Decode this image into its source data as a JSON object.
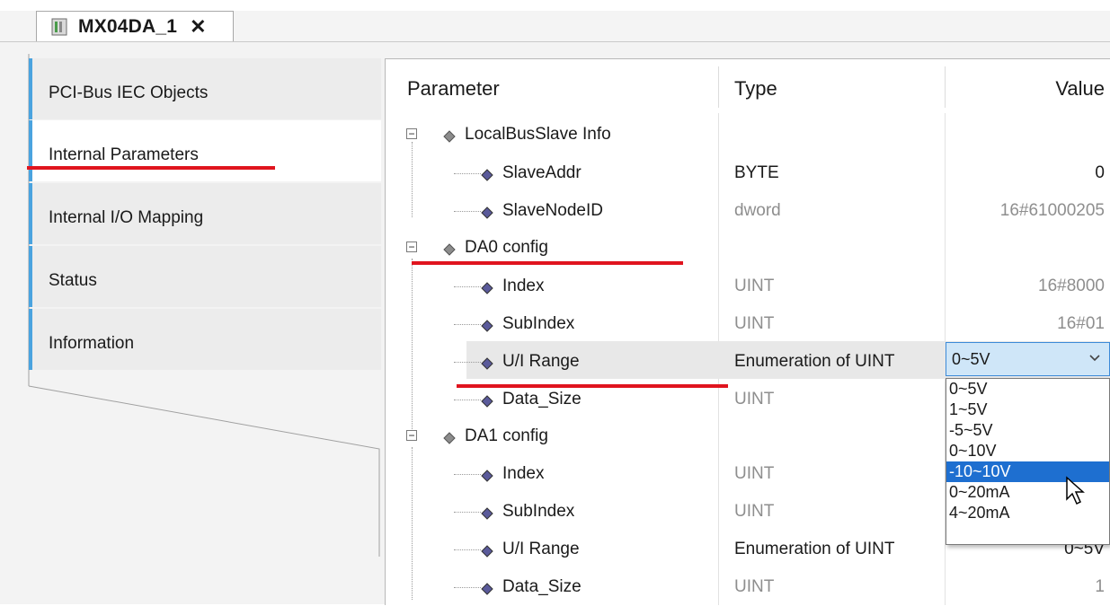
{
  "tab": {
    "title": "MX04DA_1",
    "close": "✕"
  },
  "sidebar": {
    "items": [
      {
        "label": "PCI-Bus IEC Objects"
      },
      {
        "label": "Internal Parameters"
      },
      {
        "label": "Internal I/O Mapping"
      },
      {
        "label": "Status"
      },
      {
        "label": "Information"
      }
    ]
  },
  "table": {
    "headers": {
      "parameter": "Parameter",
      "type": "Type",
      "value": "Value"
    },
    "rows": [
      {
        "label": "LocalBusSlave Info",
        "type": "",
        "value": ""
      },
      {
        "label": "SlaveAddr",
        "type": "BYTE",
        "value": "0"
      },
      {
        "label": "SlaveNodeID",
        "type": "dword",
        "value": "16#61000205"
      },
      {
        "label": "DA0 config",
        "type": "",
        "value": ""
      },
      {
        "label": "Index",
        "type": "UINT",
        "value": "16#8000"
      },
      {
        "label": "SubIndex",
        "type": "UINT",
        "value": "16#01"
      },
      {
        "label": "U/I Range",
        "type": "Enumeration of UINT",
        "value": "0~5V"
      },
      {
        "label": "Data_Size",
        "type": "UINT",
        "value": ""
      },
      {
        "label": "DA1 config",
        "type": "",
        "value": ""
      },
      {
        "label": "Index",
        "type": "UINT",
        "value": ""
      },
      {
        "label": "SubIndex",
        "type": "UINT",
        "value": ""
      },
      {
        "label": "U/I Range",
        "type": "Enumeration of UINT",
        "value": "0~5V"
      },
      {
        "label": "Data_Size",
        "type": "UINT",
        "value": "1"
      }
    ]
  },
  "dropdown": {
    "selected": "0~5V",
    "options": [
      "0~5V",
      "1~5V",
      "-5~5V",
      "0~10V",
      "-10~10V",
      "0~20mA",
      "4~20mA"
    ],
    "highlighted": "-10~10V"
  },
  "colors": {
    "accent": "#4aa3df",
    "annotation": "#e0141e",
    "highlight": "#1e6fd0"
  }
}
